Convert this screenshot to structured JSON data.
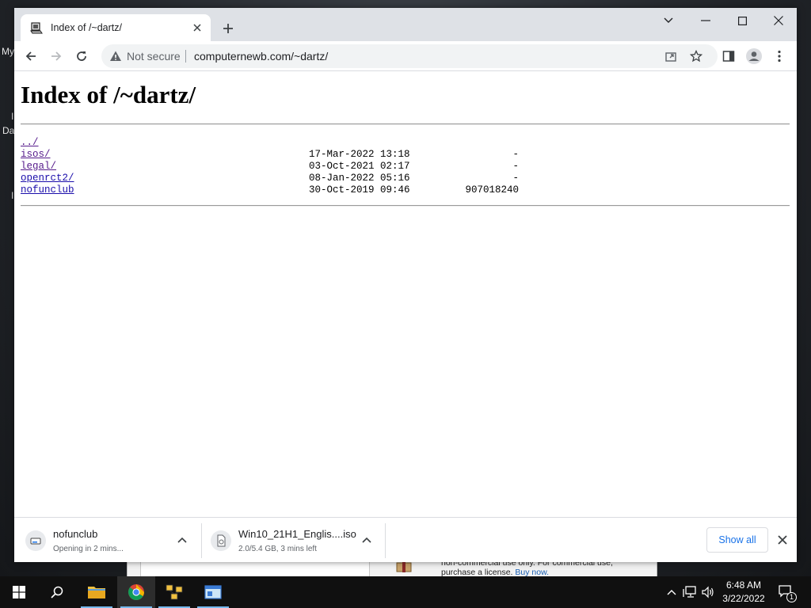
{
  "desktop": {
    "labels": [
      "My",
      "I",
      "Da",
      "I"
    ]
  },
  "background_window": {
    "text_line1": "non-commercial use only. For commercial use,",
    "text_line2": "purchase a license.",
    "buy_link": "Buy now."
  },
  "browser": {
    "tab": {
      "title": "Index of /~dartz/",
      "favicon": "server-icon"
    },
    "window_controls": {
      "tab_search": "chevron-down-icon",
      "minimize": "minimize-icon",
      "maximize": "maximize-icon",
      "close": "close-icon"
    },
    "omnibox": {
      "security_label": "Not secure",
      "url": "computernewb.com/~dartz/"
    }
  },
  "page": {
    "heading": "Index of /~dartz/",
    "entries": [
      {
        "name": "../",
        "date": "",
        "size": "",
        "visited": true
      },
      {
        "name": "isos/",
        "date": "17-Mar-2022 13:18",
        "size": "-",
        "visited": true
      },
      {
        "name": "legal/",
        "date": "03-Oct-2021 02:17",
        "size": "-",
        "visited": true
      },
      {
        "name": "openrct2/",
        "date": "08-Jan-2022 05:16",
        "size": "-",
        "visited": false
      },
      {
        "name": "nofunclub",
        "date": "30-Oct-2019 09:46",
        "size": "907018240",
        "visited": false
      }
    ]
  },
  "downloads": {
    "items": [
      {
        "name": "nofunclub",
        "status": "Opening in 2 mins..."
      },
      {
        "name": "Win10_21H1_Englis....iso",
        "status": "2.0/5.4 GB, 3 mins left"
      }
    ],
    "show_all_label": "Show all"
  },
  "taskbar": {
    "time": "6:48 AM",
    "date": "3/22/2022",
    "notification_count": "1",
    "accent_color": "#76b9ed"
  }
}
